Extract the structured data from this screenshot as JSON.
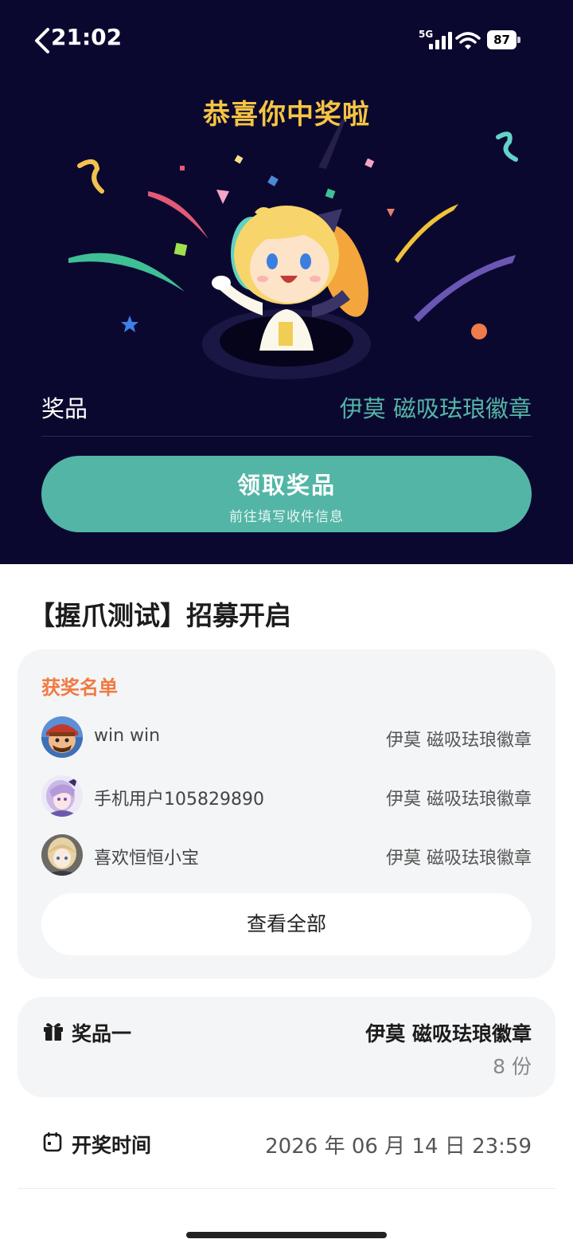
{
  "status_bar": {
    "time": "21:02",
    "network": "5G",
    "battery": "87"
  },
  "hero": {
    "congrats": "恭喜你中奖啦",
    "prize_label": "奖品",
    "prize_value": "伊莫 磁吸珐琅徽章",
    "claim_button": {
      "title": "领取奖品",
      "subtitle": "前往填写收件信息"
    }
  },
  "event": {
    "title": "【握爪测试】招募开启"
  },
  "winners": {
    "heading": "获奖名单",
    "list": [
      {
        "name": "win win",
        "prize": "伊莫 磁吸珐琅徽章"
      },
      {
        "name": "手机用户105829890",
        "prize": "伊莫 磁吸珐琅徽章"
      },
      {
        "name": "喜欢恒恒小宝",
        "prize": "伊莫 磁吸珐琅徽章"
      }
    ],
    "view_all": "查看全部"
  },
  "prize_info": {
    "label": "奖品一",
    "value": "伊莫 磁吸珐琅徽章",
    "count": "8 份"
  },
  "draw_time": {
    "label": "开奖时间",
    "value": "2026 年 06 月 14 日 23:59"
  },
  "colors": {
    "hero_bg": "#0b0830",
    "accent_teal": "#53b5a6",
    "congrats_gold": "#f5c542",
    "winner_heading_orange": "#f07a41"
  },
  "icons": [
    "back-arrow-icon",
    "signal-icon",
    "wifi-icon",
    "battery-icon",
    "gift-icon",
    "calendar-icon"
  ]
}
